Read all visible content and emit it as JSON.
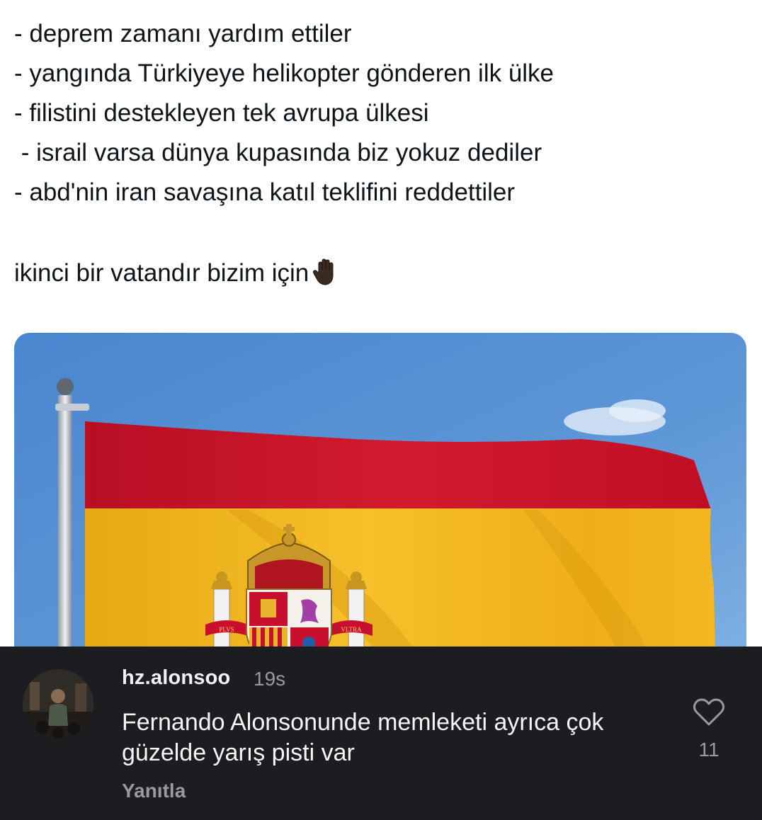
{
  "tweet": {
    "lines": [
      "- deprem zamanı yardım ettiler",
      "- yangında Türkiyeye helikopter gönderen ilk ülke",
      "- filistini destekleyen tek avrupa ülkesi",
      " - israil varsa dünya kupasında biz yokuz dediler",
      "- abd'nin iran savaşına katıl teklifini reddettiler"
    ],
    "closing": "ikinci bir vatandır bizim için",
    "closing_emoji": "raised-hand-icon"
  },
  "media": {
    "subject": "spain-flag",
    "ribbon_left": "PLVS",
    "ribbon_right": "VLTRA",
    "colors": {
      "sky": "#5b93d2",
      "red": "#c8102e",
      "yellow": "#f2b51c"
    }
  },
  "comment": {
    "username": "hz.alonsoo",
    "time": "19s",
    "text": "Fernando Alonsonunde memleketi ayrıca çok güzelde yarış pisti var",
    "reply_label": "Yanıtla",
    "like_count": "11",
    "like_icon": "heart-outline-icon"
  },
  "theme": {
    "comment_bg": "#1c1d20",
    "muted_text": "#9a9a9a"
  }
}
